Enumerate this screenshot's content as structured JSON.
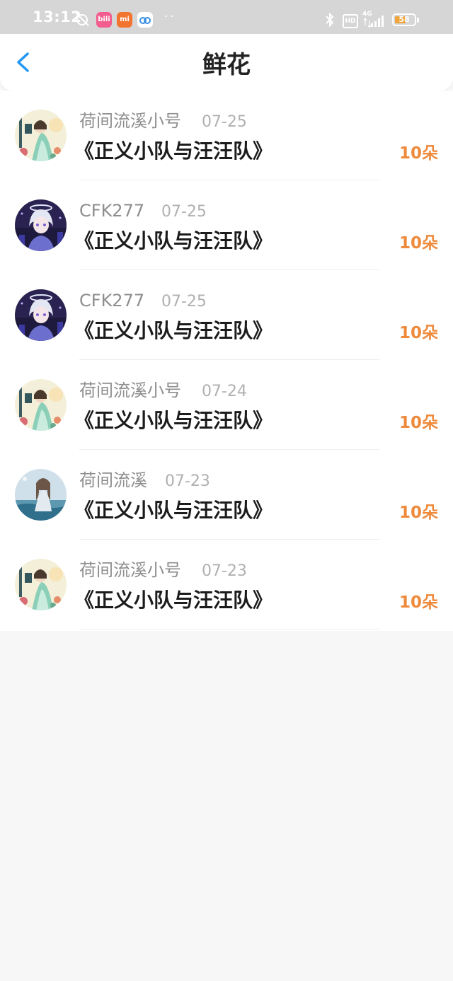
{
  "status_bar": {
    "time": "13:12",
    "app_badges": [
      {
        "name": "bilibili-app-icon",
        "text": "bili",
        "color": "#f25d8e"
      },
      {
        "name": "mi-app-icon",
        "text": "mi",
        "color": "#f3742f"
      },
      {
        "name": "cloud-app-icon",
        "text": "",
        "color": "#ffffff"
      }
    ],
    "dots": "··",
    "hd_label": "HD",
    "network_label": "4G",
    "battery_percent": "58",
    "battery_level": 0.58
  },
  "header": {
    "back_icon": "chevron-left-icon",
    "title": "鲜花"
  },
  "colors": {
    "accent_blue": "#2196f3",
    "count_orange": "#ee8a3c",
    "battery_orange": "#f0a43a"
  },
  "list": [
    {
      "user": "荷间流溪小号",
      "date": "07-25",
      "title": "《正义小队与汪汪队》",
      "count": "10朵",
      "avatar": "avatar-girl-lantern"
    },
    {
      "user": "CFK277",
      "date": "07-25",
      "title": "《正义小队与汪汪队》",
      "count": "10朵",
      "avatar": "avatar-boy-halo"
    },
    {
      "user": "CFK277",
      "date": "07-25",
      "title": "《正义小队与汪汪队》",
      "count": "10朵",
      "avatar": "avatar-boy-halo"
    },
    {
      "user": "荷间流溪小号",
      "date": "07-24",
      "title": "《正义小队与汪汪队》",
      "count": "10朵",
      "avatar": "avatar-girl-lantern"
    },
    {
      "user": "荷间流溪",
      "date": "07-23",
      "title": "《正义小队与汪汪队》",
      "count": "10朵",
      "avatar": "avatar-girl-water"
    },
    {
      "user": "荷间流溪小号",
      "date": "07-23",
      "title": "《正义小队与汪汪队》",
      "count": "10朵",
      "avatar": "avatar-girl-lantern"
    }
  ]
}
